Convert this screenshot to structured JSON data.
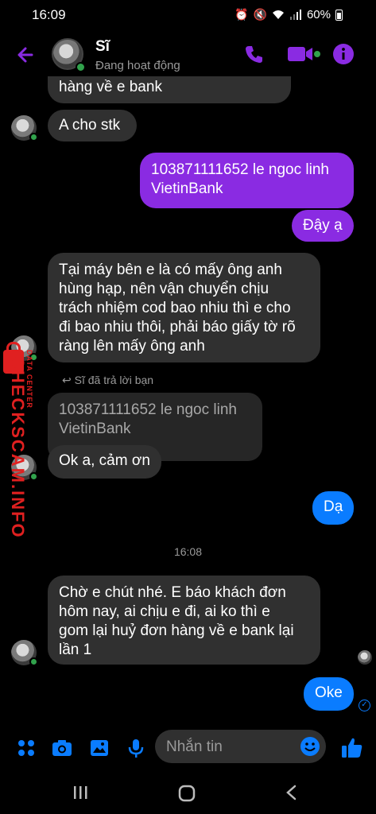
{
  "status_bar": {
    "time": "16:09",
    "battery": "60%",
    "icons": [
      "alarm-icon",
      "mute-icon",
      "wifi-icon",
      "signal-icon",
      "battery-icon"
    ]
  },
  "header": {
    "contact_name": "Sĩ",
    "contact_status": "Đang hoạt động",
    "icons": [
      "back-arrow-icon",
      "phone-icon",
      "video-camera-icon",
      "info-icon"
    ],
    "accent_color": "#8a2be2",
    "online_color": "#31a24c"
  },
  "messages": {
    "m1": "hàng về e bank",
    "m2": "A cho stk",
    "m3": "103871111652 le ngoc linh\nVietinBank",
    "m4": "Đậy ạ",
    "m5": "Tại máy bên e là có mấy ông anh\nhùng hạp, nên vận chuyển chịu\ntrách nhiệm cod bao nhiu thì e cho\nđi bao nhiu thôi, phải báo giấy tờ rõ\nràng lên mấy ông anh",
    "reply_label": "Sĩ đã trả lời bạn",
    "reply_quote": "103871111652 le ngoc linh\nVietinBank",
    "m6": "Ok a, cảm ơn",
    "m7": "Dạ",
    "timestamp": "16:08",
    "m8": "Chờ e chút nhé. E báo khách đơn\nhôm nay, ai chịu e đi, ai ko thì e\ngom lại huỷ đơn hàng về e bank lại\nlần 1",
    "m9": "Oke"
  },
  "watermark": {
    "title": "CHECKSCAM.INFO",
    "subtitle": "DATA CENTER"
  },
  "composer": {
    "placeholder": "Nhắn tin",
    "icons": [
      "menu-dots-icon",
      "camera-icon",
      "image-icon",
      "microphone-icon",
      "emoji-icon",
      "thumbs-up-icon"
    ]
  },
  "nav": {
    "icons": [
      "recent-apps-icon",
      "home-icon",
      "back-icon"
    ]
  }
}
